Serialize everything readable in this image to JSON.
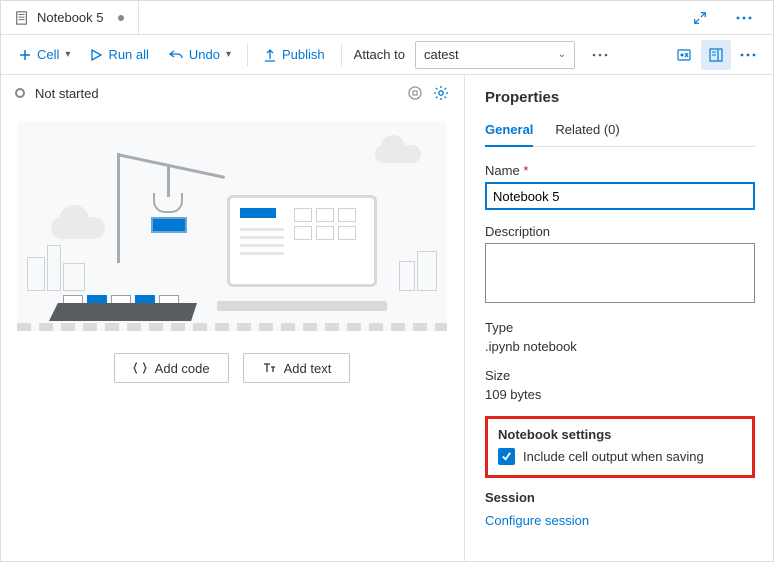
{
  "tab": {
    "title": "Notebook 5"
  },
  "toolbar": {
    "cell": "Cell",
    "run_all": "Run all",
    "undo": "Undo",
    "publish": "Publish",
    "attach_label": "Attach to",
    "attach_value": "catest"
  },
  "status": {
    "text": "Not started"
  },
  "editor": {
    "add_code": "Add code",
    "add_text": "Add text"
  },
  "panel": {
    "title": "Properties",
    "tabs": {
      "general": "General",
      "related": "Related (0)"
    },
    "name_label": "Name",
    "name_value": "Notebook 5",
    "desc_label": "Description",
    "desc_value": "",
    "type_label": "Type",
    "type_value": ".ipynb notebook",
    "size_label": "Size",
    "size_value": "109 bytes",
    "settings_head": "Notebook settings",
    "include_output": "Include cell output when saving",
    "session_head": "Session",
    "configure": "Configure session"
  }
}
